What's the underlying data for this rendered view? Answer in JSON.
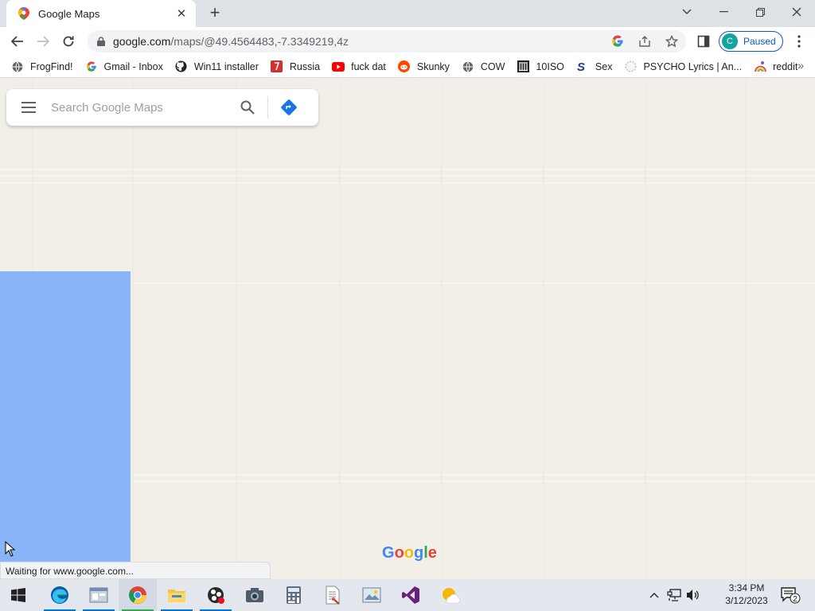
{
  "tab": {
    "title": "Google Maps",
    "close_icon": "close-icon",
    "new_tab_icon": "plus-icon"
  },
  "window": {
    "tab_search_icon": "chevron-down-icon",
    "minimize_icon": "minimize-icon",
    "restore_icon": "restore-icon",
    "close_icon": "close-icon"
  },
  "toolbar": {
    "url_host": "google.com",
    "url_path": "/maps/@49.4564483,-7.3349219,4z",
    "profile_initial": "C",
    "profile_status": "Paused"
  },
  "bookmarks": [
    {
      "label": "FrogFind!",
      "icon": "globe-icon",
      "color": "#5f6368"
    },
    {
      "label": "Gmail - Inbox",
      "icon": "google-icon",
      "color": "#4285f4"
    },
    {
      "label": "Win11 installer",
      "icon": "github-icon",
      "color": "#202124"
    },
    {
      "label": "Russia",
      "icon": "flag-icon",
      "color": "#d32f2f"
    },
    {
      "label": "fuck dat",
      "icon": "youtube-icon",
      "color": "#ff0000"
    },
    {
      "label": "Skunky",
      "icon": "reddit-icon",
      "color": "#ff4500"
    },
    {
      "label": "COW",
      "icon": "globe-icon",
      "color": "#5f6368"
    },
    {
      "label": "10ISO",
      "icon": "building-icon",
      "color": "#202124"
    },
    {
      "label": "Sex",
      "icon": "s-icon",
      "color": "#1a3f8f"
    },
    {
      "label": "PSYCHO Lyrics | An...",
      "icon": "circle-icon",
      "color": "#bdbdbd"
    },
    {
      "label": "reddit",
      "icon": "rainbow-icon",
      "color": "#ff6f61"
    }
  ],
  "map": {
    "search_placeholder": "Search Google Maps",
    "water_color": "#8ab4f8",
    "land_color": "#f2efe9",
    "logo_letters": [
      {
        "ch": "G",
        "color": "#4285f4"
      },
      {
        "ch": "o",
        "color": "#ea4335"
      },
      {
        "ch": "o",
        "color": "#fbbc05"
      },
      {
        "ch": "g",
        "color": "#4285f4"
      },
      {
        "ch": "l",
        "color": "#34a853"
      },
      {
        "ch": "e",
        "color": "#ea4335"
      }
    ]
  },
  "status": {
    "text": "Waiting for www.google.com..."
  },
  "taskbar": {
    "apps": [
      {
        "name": "edge-icon",
        "active": false
      },
      {
        "name": "file-manager-icon",
        "active": false
      },
      {
        "name": "chrome-icon",
        "active": true
      },
      {
        "name": "file-explorer-icon",
        "active": false
      },
      {
        "name": "obs-icon",
        "active": false
      },
      {
        "name": "camera-icon",
        "active": false
      },
      {
        "name": "calculator-icon",
        "active": false
      },
      {
        "name": "document-icon",
        "active": false
      },
      {
        "name": "image-viewer-icon",
        "active": false
      },
      {
        "name": "visual-studio-icon",
        "active": false
      },
      {
        "name": "weather-icon",
        "active": false
      }
    ],
    "time": "3:34 PM",
    "date": "3/12/2023",
    "notification_count": "2"
  }
}
